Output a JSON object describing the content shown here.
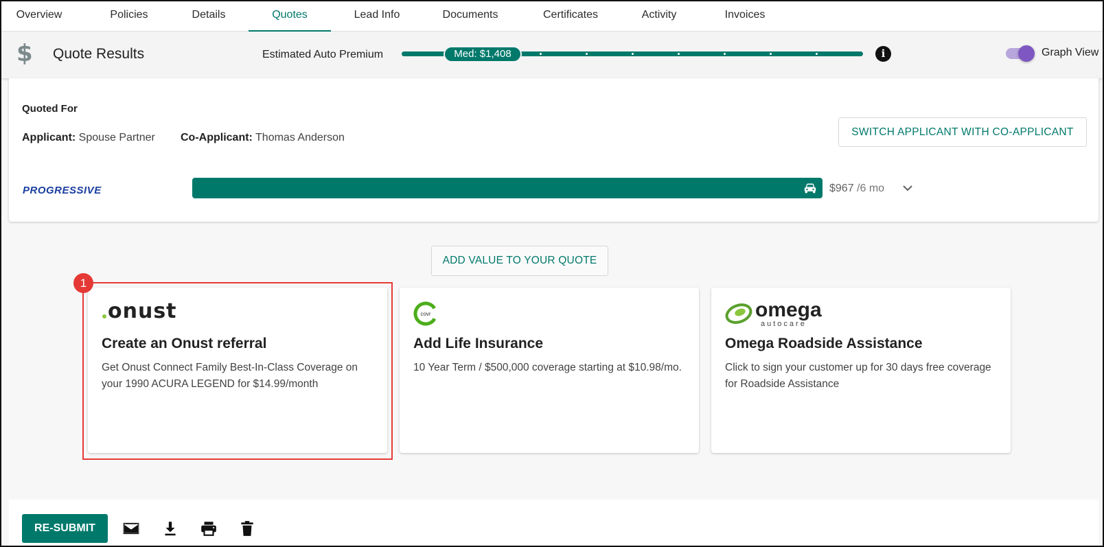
{
  "tabs": [
    {
      "label": "Overview"
    },
    {
      "label": "Policies"
    },
    {
      "label": "Details"
    },
    {
      "label": "Quotes"
    },
    {
      "label": "Lead Info"
    },
    {
      "label": "Documents"
    },
    {
      "label": "Certificates"
    },
    {
      "label": "Activity"
    },
    {
      "label": "Invoices"
    }
  ],
  "active_tab": "Quotes",
  "header": {
    "dollar_icon": "$",
    "title": "Quote Results",
    "estimate_label": "Estimated Auto Premium",
    "med_label": "Med: $1,408",
    "info_icon": "i",
    "graph_view_label": "Graph View",
    "graph_view_on": true
  },
  "quoted_for": {
    "title": "Quoted For",
    "applicant_label": "Applicant:",
    "applicant_name": "Spouse Partner",
    "co_applicant_label": "Co-Applicant:",
    "co_applicant_name": "Thomas Anderson",
    "switch_button": "SWITCH APPLICANT WITH CO-APPLICANT"
  },
  "carrier": {
    "logo_text": "PROGRESSIVE",
    "price": "$967",
    "term": " /6 mo"
  },
  "add_value_button": "ADD VALUE TO YOUR QUOTE",
  "offers": [
    {
      "logo_text": "onust",
      "title": "Create an Onust referral",
      "description": "Get Onust Connect Family Best-In-Class Coverage on your 1990 ACURA LEGEND for $14.99/month"
    },
    {
      "logo_text": "covr",
      "title": "Add Life Insurance",
      "description": "10 Year Term / $500,000 coverage starting at $10.98/mo."
    },
    {
      "logo_text": "omega",
      "logo_subtext": "autocare",
      "title": "Omega Roadside Assistance",
      "description": "Click to sign your customer up for 30 days free coverage for Roadside Assistance"
    }
  ],
  "annotation_badge": "1",
  "actions": {
    "resubmit": "RE-SUBMIT",
    "icons": [
      "email-icon",
      "download-icon",
      "print-icon",
      "delete-icon"
    ]
  },
  "colors": {
    "accent": "#00796b",
    "toggle": "#7e57c2",
    "highlight": "#e53935",
    "progressive": "#1a3ea0",
    "covr_green": "#4cae1b",
    "omega_green": "#5aa02c"
  }
}
